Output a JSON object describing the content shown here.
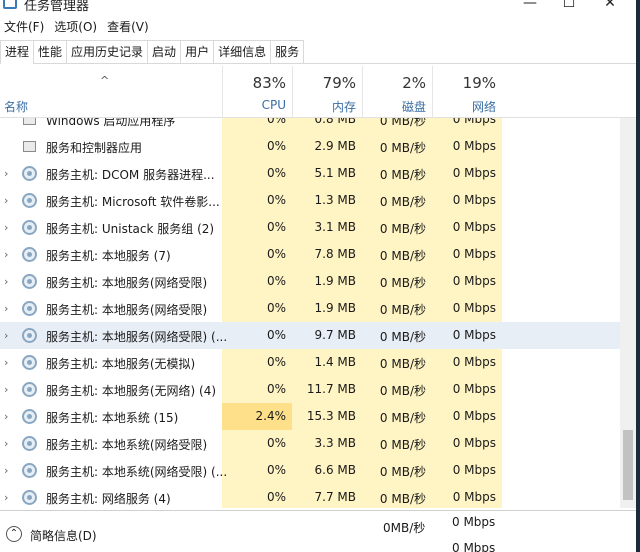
{
  "window": {
    "title": "任务管理器",
    "min": "—",
    "max": "☐",
    "close": "✕"
  },
  "menu": [
    "文件(F)",
    "选项(O)",
    "查看(V)"
  ],
  "tabs": [
    "进程",
    "性能",
    "应用历史记录",
    "启动",
    "用户",
    "详细信息",
    "服务"
  ],
  "active_tab": 0,
  "header": {
    "sort_indicator": "^",
    "name": "名称",
    "columns": [
      {
        "pct": "83%",
        "label": "CPU"
      },
      {
        "pct": "79%",
        "label": "内存"
      },
      {
        "pct": "2%",
        "label": "磁盘"
      },
      {
        "pct": "19%",
        "label": "网络"
      }
    ]
  },
  "rows": [
    {
      "name": "Windows 启动应用程序",
      "cpu": "0%",
      "mem": "0.8 MB",
      "disk": "0 MB/秒",
      "net": "0 Mbps",
      "icon": "service-icon",
      "expandable": false
    },
    {
      "name": "服务和控制器应用",
      "cpu": "0%",
      "mem": "2.9 MB",
      "disk": "0 MB/秒",
      "net": "0 Mbps",
      "icon": "service-icon",
      "expandable": false
    },
    {
      "name": "服务主机: DCOM 服务器进程...",
      "cpu": "0%",
      "mem": "5.1 MB",
      "disk": "0 MB/秒",
      "net": "0 Mbps",
      "icon": "gear-icon",
      "expandable": true
    },
    {
      "name": "服务主机: Microsoft 软件卷影...",
      "cpu": "0%",
      "mem": "1.3 MB",
      "disk": "0 MB/秒",
      "net": "0 Mbps",
      "icon": "gear-icon",
      "expandable": true
    },
    {
      "name": "服务主机: Unistack 服务组 (2)",
      "cpu": "0%",
      "mem": "3.1 MB",
      "disk": "0 MB/秒",
      "net": "0 Mbps",
      "icon": "gear-icon",
      "expandable": true
    },
    {
      "name": "服务主机: 本地服务 (7)",
      "cpu": "0%",
      "mem": "7.8 MB",
      "disk": "0 MB/秒",
      "net": "0 Mbps",
      "icon": "gear-icon",
      "expandable": true
    },
    {
      "name": "服务主机: 本地服务(网络受限)",
      "cpu": "0%",
      "mem": "1.9 MB",
      "disk": "0 MB/秒",
      "net": "0 Mbps",
      "icon": "gear-icon",
      "expandable": true
    },
    {
      "name": "服务主机: 本地服务(网络受限)",
      "cpu": "0%",
      "mem": "1.9 MB",
      "disk": "0 MB/秒",
      "net": "0 Mbps",
      "icon": "gear-icon",
      "expandable": true
    },
    {
      "name": "服务主机: 本地服务(网络受限) (...",
      "cpu": "0%",
      "mem": "9.7 MB",
      "disk": "0 MB/秒",
      "net": "0 Mbps",
      "icon": "gear-icon",
      "expandable": true,
      "selected": true
    },
    {
      "name": "服务主机: 本地服务(无模拟)",
      "cpu": "0%",
      "mem": "1.4 MB",
      "disk": "0 MB/秒",
      "net": "0 Mbps",
      "icon": "gear-icon",
      "expandable": true
    },
    {
      "name": "服务主机: 本地服务(无网络) (4)",
      "cpu": "0%",
      "mem": "11.7 MB",
      "disk": "0 MB/秒",
      "net": "0 Mbps",
      "icon": "gear-icon",
      "expandable": true
    },
    {
      "name": "服务主机: 本地系统 (15)",
      "cpu": "2.4%",
      "mem": "15.3 MB",
      "disk": "0 MB/秒",
      "net": "0 Mbps",
      "icon": "gear-icon",
      "expandable": true,
      "cpu_hot": true
    },
    {
      "name": "服务主机: 本地系统(网络受限)",
      "cpu": "0%",
      "mem": "3.3 MB",
      "disk": "0 MB/秒",
      "net": "0 Mbps",
      "icon": "gear-icon",
      "expandable": true
    },
    {
      "name": "服务主机: 本地系统(网络受限) (...",
      "cpu": "0%",
      "mem": "6.6 MB",
      "disk": "0 MB/秒",
      "net": "0 Mbps",
      "icon": "gear-icon",
      "expandable": true
    },
    {
      "name": "服务主机: 网络服务 (4)",
      "cpu": "0%",
      "mem": "7.7 MB",
      "disk": "0 MB/秒",
      "net": "0 Mbps",
      "icon": "gear-icon",
      "expandable": true
    }
  ],
  "footer": {
    "label": "简略信息(D)",
    "ghost": [
      "0MB/秒",
      "0 Mbps",
      "0 Mbps"
    ]
  },
  "colors": {
    "heat_light": "#fff4c4",
    "heat_hot": "#ffe08a",
    "header_label": "#3a6ea5",
    "selected_row": "#e8eef5"
  }
}
